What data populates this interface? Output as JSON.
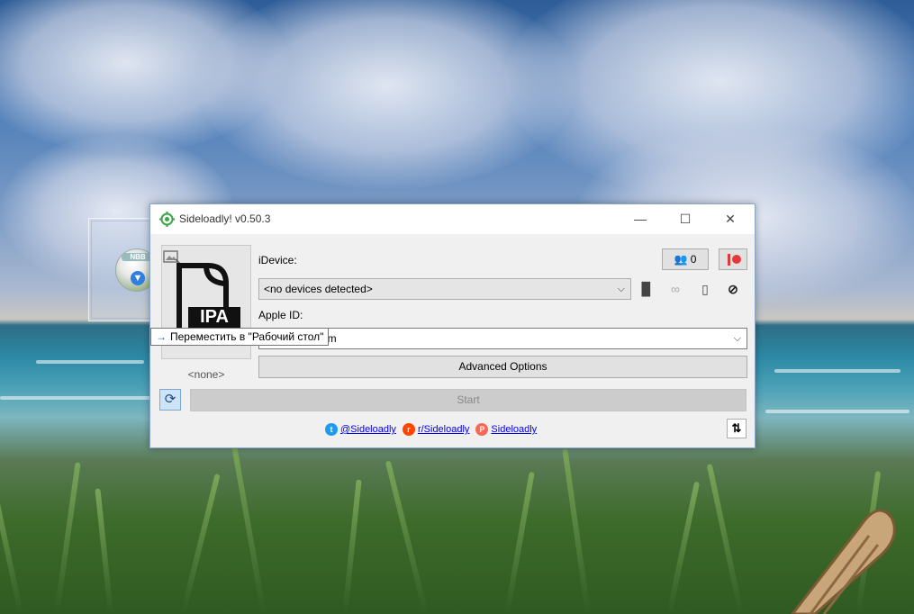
{
  "window": {
    "title": "Sideloadly! v0.50.3",
    "minimize": "—",
    "maximize": "☐",
    "close": "✕"
  },
  "ipa": {
    "file_label": "IPA",
    "none_label": "<none>"
  },
  "device": {
    "label": "iDevice:",
    "account_count": "0",
    "selected": "<no devices detected>"
  },
  "apple_id": {
    "label": "Apple ID:",
    "value": "com"
  },
  "buttons": {
    "advanced": "Advanced Options",
    "start": "Start"
  },
  "social": {
    "twitter": "@Sideloadly",
    "reddit": "r/Sideloadly",
    "patreon": "Sideloadly"
  },
  "drag_tooltip": {
    "text": "Переместить в \"Рабочий стол\""
  },
  "desktop_icon": {
    "label": "NBB"
  },
  "icons": {
    "app": "sideloadly-gear-icon",
    "image": "image-icon",
    "account": "account-icon",
    "record": "patreon-record-icon",
    "doc": "document-icon",
    "link": "link-icon",
    "phone": "phone-icon",
    "eye": "eye-slash-icon",
    "refresh": "refresh-icon",
    "sort": "sort-icon"
  },
  "colors": {
    "accent": "#1a5fb4",
    "record": "#e23a3a",
    "twitter": "#1d9bf0",
    "reddit": "#ff4500",
    "patreon": "#f96854"
  }
}
